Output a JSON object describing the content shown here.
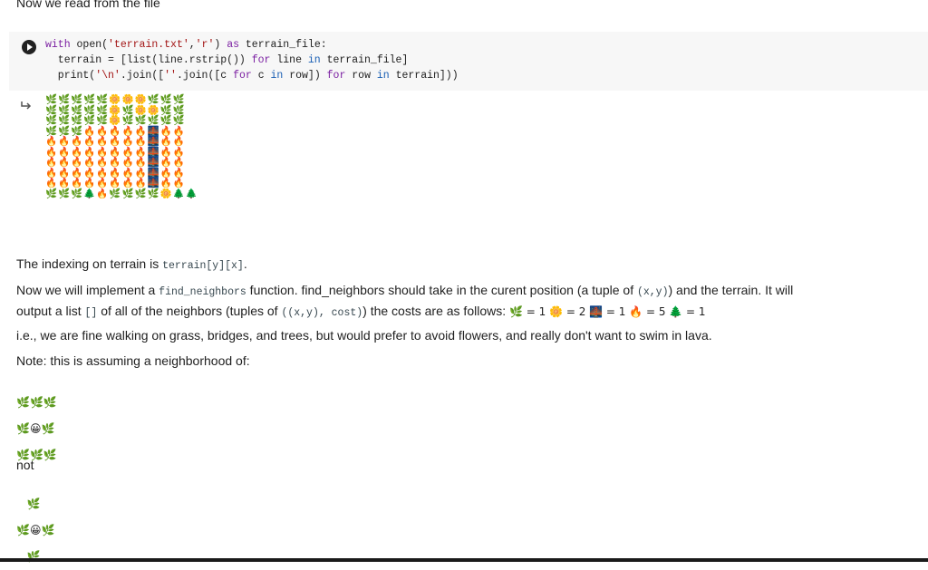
{
  "top_text": "Now we read from the file",
  "code": {
    "line1": {
      "kw1": "with",
      "fn": " open(",
      "s1": "'terrain.txt'",
      "c1": ",",
      "s2": "'r'",
      "c2": ") ",
      "kw2": "as",
      "rest": " terrain_file:"
    },
    "line2": {
      "p1": "  terrain = [list(line.rstrip()) ",
      "kw1": "for",
      "p2": " line ",
      "kw2": "in",
      "p3": " terrain_file]"
    },
    "line3": {
      "fn": "  print(",
      "s1": "'\\n'",
      "p1": ".join([",
      "s2": "''",
      "p2": ".join([c ",
      "kw1": "for",
      "p3": " c ",
      "kw2": "in",
      "p4": " row]) ",
      "kw3": "for",
      "p5": " row ",
      "kw4": "in",
      "p6": " terrain]))"
    }
  },
  "terrain_output": "🌿🌿🌿🌿🌿🌼🌼🌼🌿🌿🌿\n🌿🌿🌿🌿🌿🌼🌿🌼🌼🌿🌿\n🌿🌿🌿🌿🌿🌼🌿🌿🌿🌿🌿\n🌿🌿🌿🔥🔥🔥🔥🔥🌉🔥🔥\n🔥🔥🔥🔥🔥🔥🔥🔥🌉🔥🔥\n🔥🔥🔥🔥🔥🔥🔥🔥🌉🔥🔥\n🔥🔥🔥🔥🔥🔥🔥🔥🌉🔥🔥\n🔥🔥🔥🔥🔥🔥🔥🔥🌉🔥🔥\n🔥🔥🔥🔥🔥🔥🔥🔥🌉🔥🔥\n🌿🌿🌿🌲🔥🌿🌿🌿🌿🌼🌲🌲",
  "indexing": {
    "before": "The indexing on terrain is ",
    "code": "terrain[y][x]",
    "after": "."
  },
  "impl": {
    "p1": "Now we will implement a ",
    "code1": "find_neighbors",
    "p2": " function. find_neighbors should take in the curent position (a tuple of ",
    "code2": "(x,y)",
    "p3": ") and the terrain. It will",
    "p4": "output a list ",
    "code3": "[]",
    "p5": " of all of the neighbors (tuples of ",
    "code4": "((x,y), cost)",
    "p6": ") the costs are as follows: ",
    "costs": "🌿 = 1 🌼 = 2 🌉 = 1 🔥 = 5 🌲 = 1"
  },
  "ie_text": "i.e., we are fine walking on grass, bridges, and trees, but would prefer to avoid flowers, and really don't want to swim in lava.",
  "note_text": "Note: this is assuming a neighborhood of:",
  "neighborhood_good": "🌿🌿🌿\n🌿😀🌿\n🌿🌿🌿",
  "not_text": "not",
  "neighborhood_bad": "   🌿\n🌿😀🌿\n   🌿"
}
